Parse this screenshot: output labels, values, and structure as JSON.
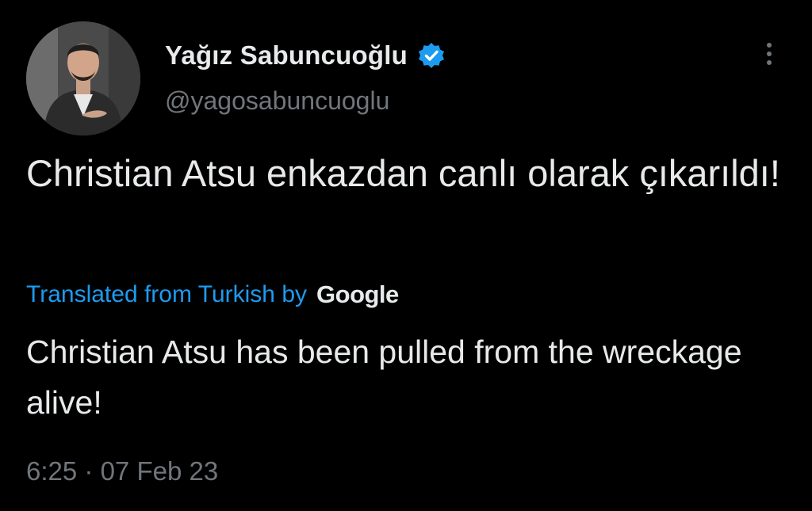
{
  "author": {
    "display_name": "Yağız Sabuncuoğlu",
    "handle": "@yagosabuncuoglu",
    "verified": true,
    "avatar_icon": "profile-photo"
  },
  "tweet": {
    "original_text": "Christian Atsu enkazdan canlı olarak çıkarıldı!",
    "translation_label": "Translated from Turkish by",
    "translation_provider": "Google",
    "translated_text": "Christian Atsu has been pulled from the wreckage alive!",
    "time": "6:25",
    "separator": "·",
    "date": "07 Feb 23"
  },
  "icons": {
    "verified": "verified-badge-icon",
    "more": "more-options-icon"
  },
  "colors": {
    "background": "#000000",
    "text_primary": "#e7e9ea",
    "text_secondary": "#71767b",
    "accent": "#1d9bf0"
  }
}
